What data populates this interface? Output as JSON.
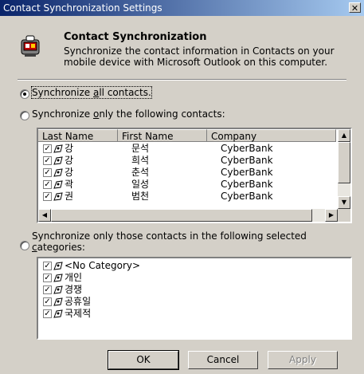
{
  "window": {
    "title": "Contact Synchronization Settings",
    "close_glyph": "✕"
  },
  "header": {
    "title": "Contact Synchronization",
    "description": "Synchronize the contact information in Contacts on your mobile device with Microsoft Outlook on this computer.",
    "icon": "device-sync-icon"
  },
  "options": {
    "all": {
      "pre": "Synchronize ",
      "u": "a",
      "post": "ll contacts.",
      "selected": true
    },
    "only": {
      "pre": "Synchronize ",
      "u": "o",
      "post": "nly the following contacts:",
      "selected": false
    },
    "categories": {
      "line1": "Synchronize only those contacts in the following selected",
      "u": "c",
      "line2": "ategories:",
      "selected": false
    }
  },
  "contacts": {
    "columns": [
      "Last Name",
      "First Name",
      "Company"
    ],
    "rows": [
      {
        "last": "강",
        "first": "문석",
        "company": "CyberBank",
        "checked": true
      },
      {
        "last": "강",
        "first": "희석",
        "company": "CyberBank",
        "checked": true
      },
      {
        "last": "강",
        "first": "춘석",
        "company": "CyberBank",
        "checked": true
      },
      {
        "last": "곽",
        "first": "일성",
        "company": "CyberBank",
        "checked": true
      },
      {
        "last": "권",
        "first": "범천",
        "company": "CyberBank",
        "checked": true
      }
    ]
  },
  "categories": [
    {
      "name": "<No Category>",
      "checked": true
    },
    {
      "name": "개인",
      "checked": true
    },
    {
      "name": "경쟁",
      "checked": true
    },
    {
      "name": "공휴일",
      "checked": true
    },
    {
      "name": "국제적",
      "checked": true
    }
  ],
  "buttons": {
    "ok": "OK",
    "cancel": "Cancel",
    "apply": "Apply"
  },
  "colors": {
    "title_start": "#0a246a",
    "title_end": "#a6caf0",
    "face": "#d4d0c8"
  }
}
